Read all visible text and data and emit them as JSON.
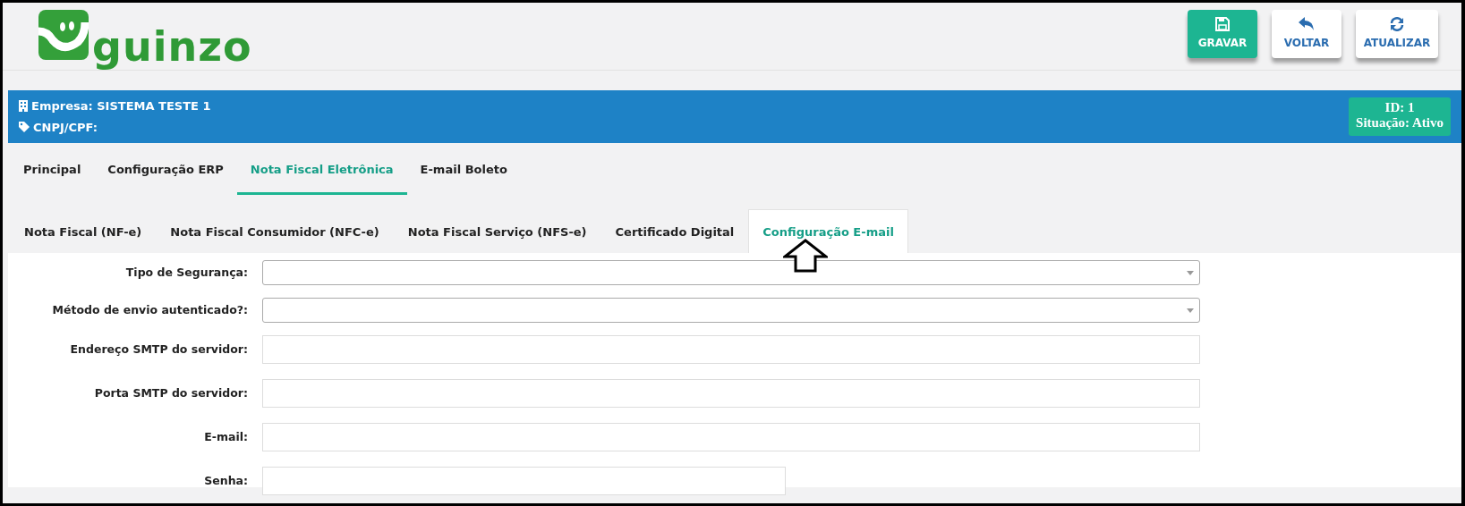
{
  "header": {
    "logo_text": "guinzo",
    "buttons": [
      {
        "label": "GRAVAR",
        "kind": "save",
        "primary": true
      },
      {
        "label": "VOLTAR",
        "kind": "back",
        "primary": false
      },
      {
        "label": "ATUALIZAR",
        "kind": "refresh",
        "primary": false
      }
    ]
  },
  "company_bar": {
    "company": "Empresa: SISTEMA TESTE 1",
    "document": "CNPJ/CPF:",
    "id": "ID: 1",
    "status": "Situação: Ativo"
  },
  "tabs": [
    {
      "label": "Principal",
      "selected": false
    },
    {
      "label": "Configuração ERP",
      "selected": false
    },
    {
      "label": "Nota Fiscal Eletrônica",
      "selected": true
    },
    {
      "label": "E-mail Boleto",
      "selected": false
    }
  ],
  "subtabs": [
    {
      "label": "Nota Fiscal (NF-e)",
      "selected": false
    },
    {
      "label": "Nota Fiscal Consumidor (NFC-e)",
      "selected": false
    },
    {
      "label": "Nota Fiscal Serviço (NFS-e)",
      "selected": false
    },
    {
      "label": "Certificado Digital",
      "selected": false
    },
    {
      "label": "Configuração E-mail",
      "selected": true
    }
  ],
  "form": [
    {
      "label": "Tipo de Segurança:",
      "kind": "select"
    },
    {
      "label": "Método de envio autenticado?:",
      "kind": "select"
    },
    {
      "label": "Endereço SMTP do servidor:",
      "kind": "text"
    },
    {
      "label": "Porta SMTP do servidor:",
      "kind": "text"
    },
    {
      "label": "E-mail:",
      "kind": "text"
    },
    {
      "label": "Senha:",
      "kind": "short"
    }
  ]
}
